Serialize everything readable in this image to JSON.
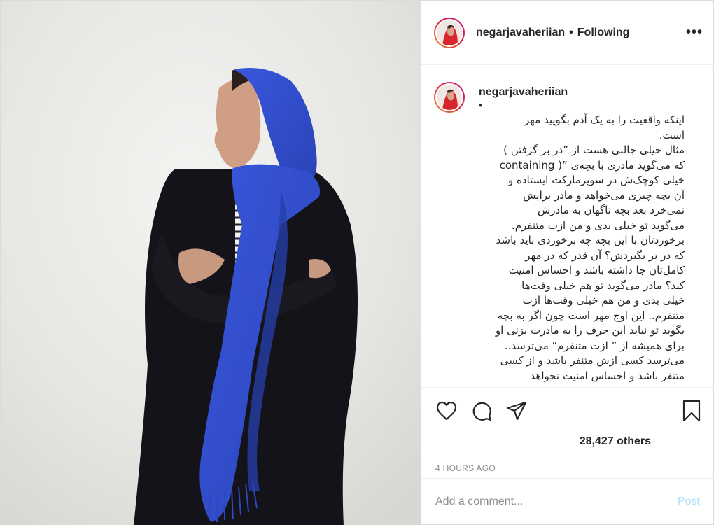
{
  "header": {
    "username": "negarjavaheriian",
    "separator": "•",
    "follow_status": "Following",
    "more_label": "•••"
  },
  "caption": {
    "username": "negarjavaheriian",
    "bullet": "•",
    "lines": [
      "اینکه واقعیت را به یک آدم بگویید مهر",
      "است.",
      "مثال خیلی جالبی هست از ”در بر گرفتن )",
      "که می‌گوید مادری با بچه‌ی ”( containing",
      "خیلی کوچک‌ش در سوپرمارکت ایستاده و",
      "آن بچه چیزی می‌خواهد و مادر برایش",
      "نمی‌خرد بعد بچه ناگهان به مادرش",
      "می‌گوید تو خیلی بدی و من ازت متنفرم.",
      "برخوردتان با این بچه چه برخوردی باید باشد",
      "که در بر بگیردش؟ آن قدر که در مهر",
      "کامل‌تان جا داشته باشد و احساس امنیت",
      "کند؟ مادر می‌گوید تو هم خیلی وقت‌ها",
      "خیلی بدی و من هم خیلی وقت‌ها ازت",
      "متنفرم.. این اوج مهر است چون اگر به بچه",
      "بگوید تو نباید این حرف را به مادرت بزنی او",
      "برای همیشه از ” ازت متنفرم” می‌ترسد..",
      "می‌ترسد کسی ازش متنفر باشد و از کسی",
      "متنفر باشد و احساس امنیت نخواهد"
    ]
  },
  "actions": {
    "like_icon": "heart-icon",
    "comment_icon": "speech-bubble-icon",
    "share_icon": "paper-plane-icon",
    "save_icon": "bookmark-icon"
  },
  "likes_text": "28,427 others",
  "timestamp": "4 HOURS AGO",
  "comment_box": {
    "placeholder": "Add a comment...",
    "post_label": "Post"
  },
  "colors": {
    "scarf_blue": "#2f4fd0",
    "post_button_disabled": "#b2dffc",
    "muted_text": "#8e8e8e"
  }
}
